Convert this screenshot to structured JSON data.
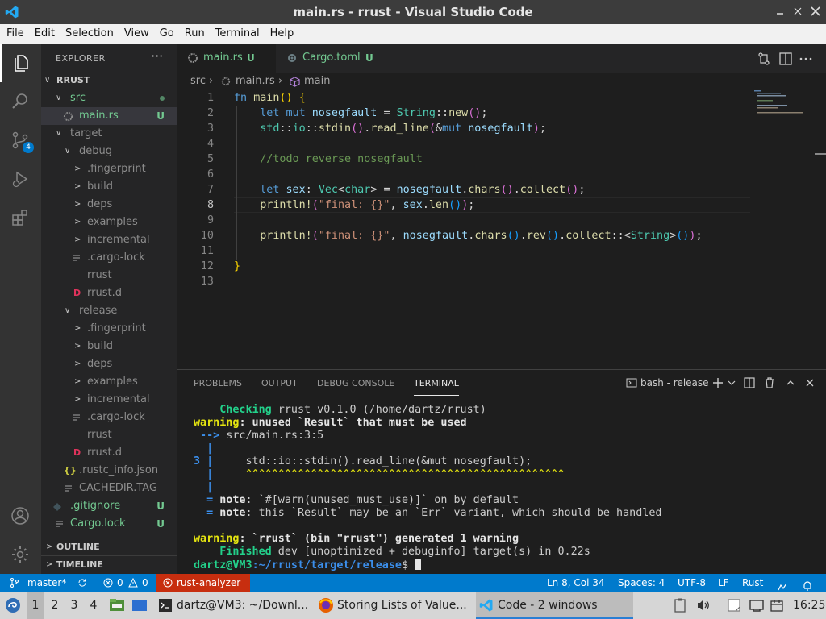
{
  "titlebar": {
    "title": "main.rs - rrust - Visual Studio Code"
  },
  "menu": [
    "File",
    "Edit",
    "Selection",
    "View",
    "Go",
    "Run",
    "Terminal",
    "Help"
  ],
  "activity": {
    "source_control_badge": "4"
  },
  "explorer": {
    "header": "EXPLORER",
    "more": "···",
    "root": "RRUST",
    "rows": [
      {
        "label": "src",
        "indent": 1,
        "kind": "folder-open",
        "color": "#73c991",
        "dot": true
      },
      {
        "label": "main.rs",
        "indent": 2,
        "kind": "rs",
        "color": "#73c991",
        "status": "U",
        "selected": true
      },
      {
        "label": "target",
        "indent": 1,
        "kind": "folder-open",
        "color": "#8c8c8c"
      },
      {
        "label": "debug",
        "indent": 2,
        "kind": "folder-open",
        "color": "#8c8c8c"
      },
      {
        "label": ".fingerprint",
        "indent": 3,
        "kind": "folder",
        "color": "#8c8c8c"
      },
      {
        "label": "build",
        "indent": 3,
        "kind": "folder",
        "color": "#8c8c8c"
      },
      {
        "label": "deps",
        "indent": 3,
        "kind": "folder",
        "color": "#8c8c8c"
      },
      {
        "label": "examples",
        "indent": 3,
        "kind": "folder",
        "color": "#8c8c8c"
      },
      {
        "label": "incremental",
        "indent": 3,
        "kind": "folder",
        "color": "#8c8c8c"
      },
      {
        "label": ".cargo-lock",
        "indent": 3,
        "kind": "lines",
        "color": "#8c8c8c"
      },
      {
        "label": "rrust",
        "indent": 3,
        "kind": "file",
        "color": "#8c8c8c"
      },
      {
        "label": "rrust.d",
        "indent": 3,
        "kind": "d",
        "color": "#8c8c8c"
      },
      {
        "label": "release",
        "indent": 2,
        "kind": "folder-open",
        "color": "#8c8c8c"
      },
      {
        "label": ".fingerprint",
        "indent": 3,
        "kind": "folder",
        "color": "#8c8c8c"
      },
      {
        "label": "build",
        "indent": 3,
        "kind": "folder",
        "color": "#8c8c8c"
      },
      {
        "label": "deps",
        "indent": 3,
        "kind": "folder",
        "color": "#8c8c8c"
      },
      {
        "label": "examples",
        "indent": 3,
        "kind": "folder",
        "color": "#8c8c8c"
      },
      {
        "label": "incremental",
        "indent": 3,
        "kind": "folder",
        "color": "#8c8c8c"
      },
      {
        "label": ".cargo-lock",
        "indent": 3,
        "kind": "lines",
        "color": "#8c8c8c"
      },
      {
        "label": "rrust",
        "indent": 3,
        "kind": "file",
        "color": "#8c8c8c"
      },
      {
        "label": "rrust.d",
        "indent": 3,
        "kind": "d",
        "color": "#8c8c8c"
      },
      {
        "label": ".rustc_info.json",
        "indent": 2,
        "kind": "json",
        "color": "#8c8c8c"
      },
      {
        "label": "CACHEDIR.TAG",
        "indent": 2,
        "kind": "lines",
        "color": "#8c8c8c"
      },
      {
        "label": ".gitignore",
        "indent": 1,
        "kind": "git",
        "color": "#73c991",
        "status": "U"
      },
      {
        "label": "Cargo.lock",
        "indent": 1,
        "kind": "lines",
        "color": "#73c991",
        "status": "U"
      }
    ],
    "sections": [
      "OUTLINE",
      "TIMELINE"
    ]
  },
  "tabs": [
    {
      "label": "main.rs",
      "status": "U",
      "active": true
    },
    {
      "label": "Cargo.toml",
      "status": "U",
      "active": false
    }
  ],
  "breadcrumb": {
    "folder": "src",
    "file": "main.rs",
    "symbol": "main"
  },
  "editor": {
    "current_line": 8,
    "line_count": 13
  },
  "panel": {
    "tabs": [
      "PROBLEMS",
      "OUTPUT",
      "DEBUG CONSOLE",
      "TERMINAL"
    ],
    "active_tab": "TERMINAL",
    "terminal_selector": "bash - release"
  },
  "terminal": {
    "l1a": "Checking",
    "l1b": " rrust v0.1.0 (/home/dartz/rrust)",
    "l2a": "warning",
    "l2b": ": unused `Result` that must be used",
    "l3a": " -->",
    "l3b": " src/main.rs:3:5",
    "l5a": "3 |",
    "l5b": "     std::io::stdin().read_line(&mut nosegfault);",
    "l6": "^^^^^^^^^^^^^^^^^^^^^^^^^^^^^^^^^^^^^^^^^^^^^^^^^",
    "l8a": "  = ",
    "l8b": "note",
    "l8c": ": `#[warn(unused_must_use)]` on by default",
    "l9a": "  = ",
    "l9b": "note",
    "l9c": ": this `Result` may be an `Err` variant, which should be handled",
    "l11a": "warning",
    "l11b": ": `rrust` (bin \"rrust\") generated 1 warning",
    "l12a": "Finished",
    "l12b": " dev [unoptimized + debuginfo] target(s) in 0.22s",
    "prompt_user": "dartz@VM3",
    "prompt_path": ":~/rrust/target/release",
    "prompt_sym": "$ "
  },
  "statusbar": {
    "branch": "master*",
    "errors": "0",
    "warnings": "0",
    "analyzer": "rust-analyzer",
    "position": "Ln 8, Col 34",
    "spaces": "Spaces: 4",
    "encoding": "UTF-8",
    "eol": "LF",
    "language": "Rust"
  },
  "taskbar": {
    "workspaces": [
      "1",
      "2",
      "3",
      "4"
    ],
    "windows": [
      {
        "label": "dartz@VM3: ~/Downl...",
        "icon": "terminal-icon"
      },
      {
        "label": "Storing Lists of Value...",
        "icon": "firefox-icon"
      },
      {
        "label": "Code - 2 windows",
        "icon": "vscode-icon",
        "active": true
      }
    ],
    "clock": "16:25"
  },
  "colors": {
    "accent": "#007acc",
    "untracked": "#73c991",
    "error_bg": "#c72e0f"
  }
}
